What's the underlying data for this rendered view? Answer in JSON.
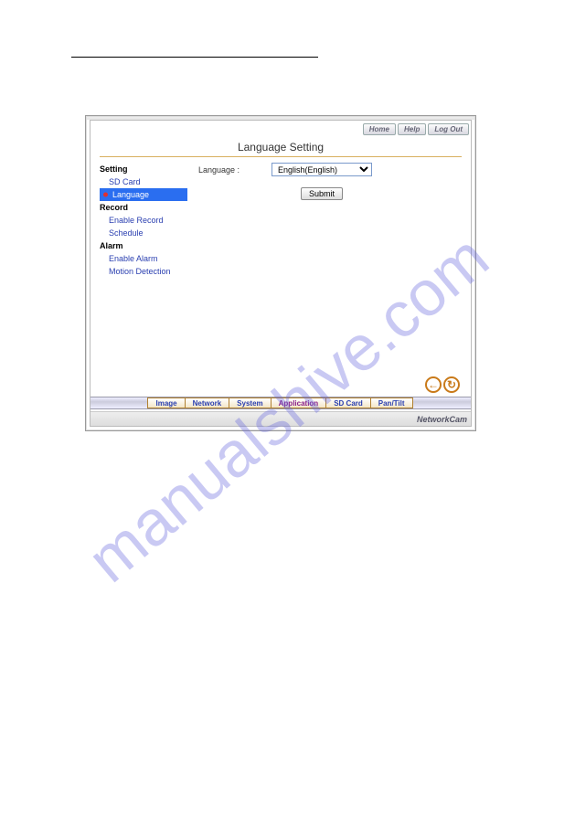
{
  "watermark": "manualshive.com",
  "topbar": {
    "home": "Home",
    "help": "Help",
    "logout": "Log Out"
  },
  "page": {
    "title": "Language Setting"
  },
  "sidebar": {
    "groups": [
      {
        "heading": "Setting",
        "items": [
          {
            "label": "SD Card",
            "active": false
          },
          {
            "label": "Language",
            "active": true
          }
        ]
      },
      {
        "heading": "Record",
        "items": [
          {
            "label": "Enable Record",
            "active": false
          },
          {
            "label": "Schedule",
            "active": false
          }
        ]
      },
      {
        "heading": "Alarm",
        "items": [
          {
            "label": "Enable Alarm",
            "active": false
          },
          {
            "label": "Motion Detection",
            "active": false
          }
        ]
      }
    ]
  },
  "form": {
    "language_label": "Language :",
    "language_value": "English(English)",
    "submit_label": "Submit"
  },
  "nav_icons": {
    "back": "←",
    "reload": "↻"
  },
  "tabs": [
    {
      "label": "Image",
      "active": false
    },
    {
      "label": "Network",
      "active": false
    },
    {
      "label": "System",
      "active": false
    },
    {
      "label": "Application",
      "active": true
    },
    {
      "label": "SD Card",
      "active": false
    },
    {
      "label": "Pan/Tilt",
      "active": false
    }
  ],
  "footer": {
    "brand": "NetworkCam"
  }
}
